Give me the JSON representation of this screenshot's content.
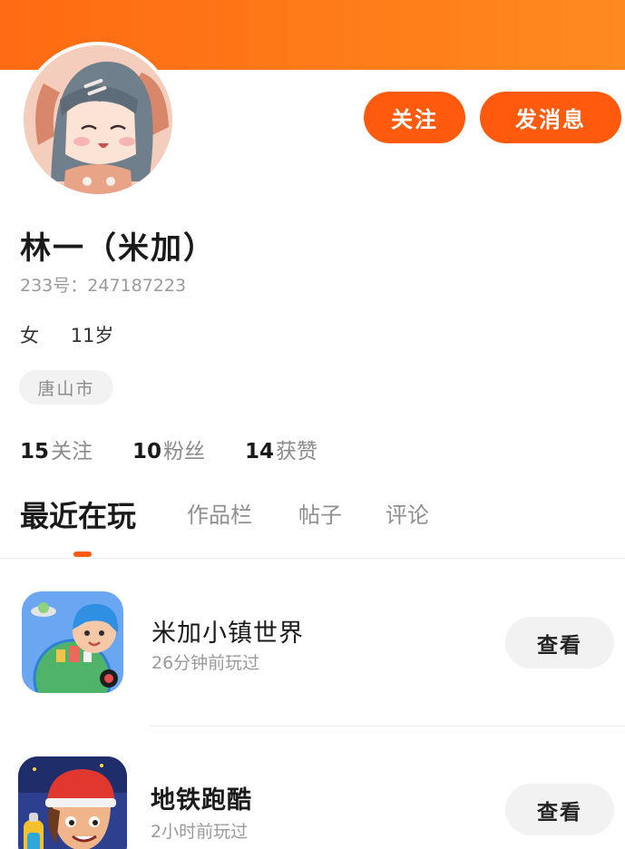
{
  "colors": {
    "accent": "#ff5a0d",
    "header": "#ff7a18",
    "chip_bg": "#f2f2f2"
  },
  "header": {
    "avatar_icon": "anime-girl-avatar",
    "follow_label": "关注",
    "message_label": "发消息"
  },
  "profile": {
    "name": "林一（米加）",
    "uid": "233号：247187223",
    "gender": "女",
    "age": "11岁",
    "city": "唐山市"
  },
  "stats": [
    {
      "value": "15",
      "label": "关注"
    },
    {
      "value": "10",
      "label": "粉丝"
    },
    {
      "value": "14",
      "label": "获赞"
    }
  ],
  "tabs": [
    {
      "label": "最近在玩",
      "active": true
    },
    {
      "label": "作品栏",
      "active": false
    },
    {
      "label": "帖子",
      "active": false
    },
    {
      "label": "评论",
      "active": false
    }
  ],
  "games": [
    {
      "title": "米加小镇世界",
      "played": "26分钟前玩过",
      "action": "查看",
      "icon": "miga-world-app-icon"
    },
    {
      "title": "地铁跑酷",
      "played": "2小时前玩过",
      "action": "查看",
      "icon": "subway-surfers-app-icon"
    }
  ]
}
